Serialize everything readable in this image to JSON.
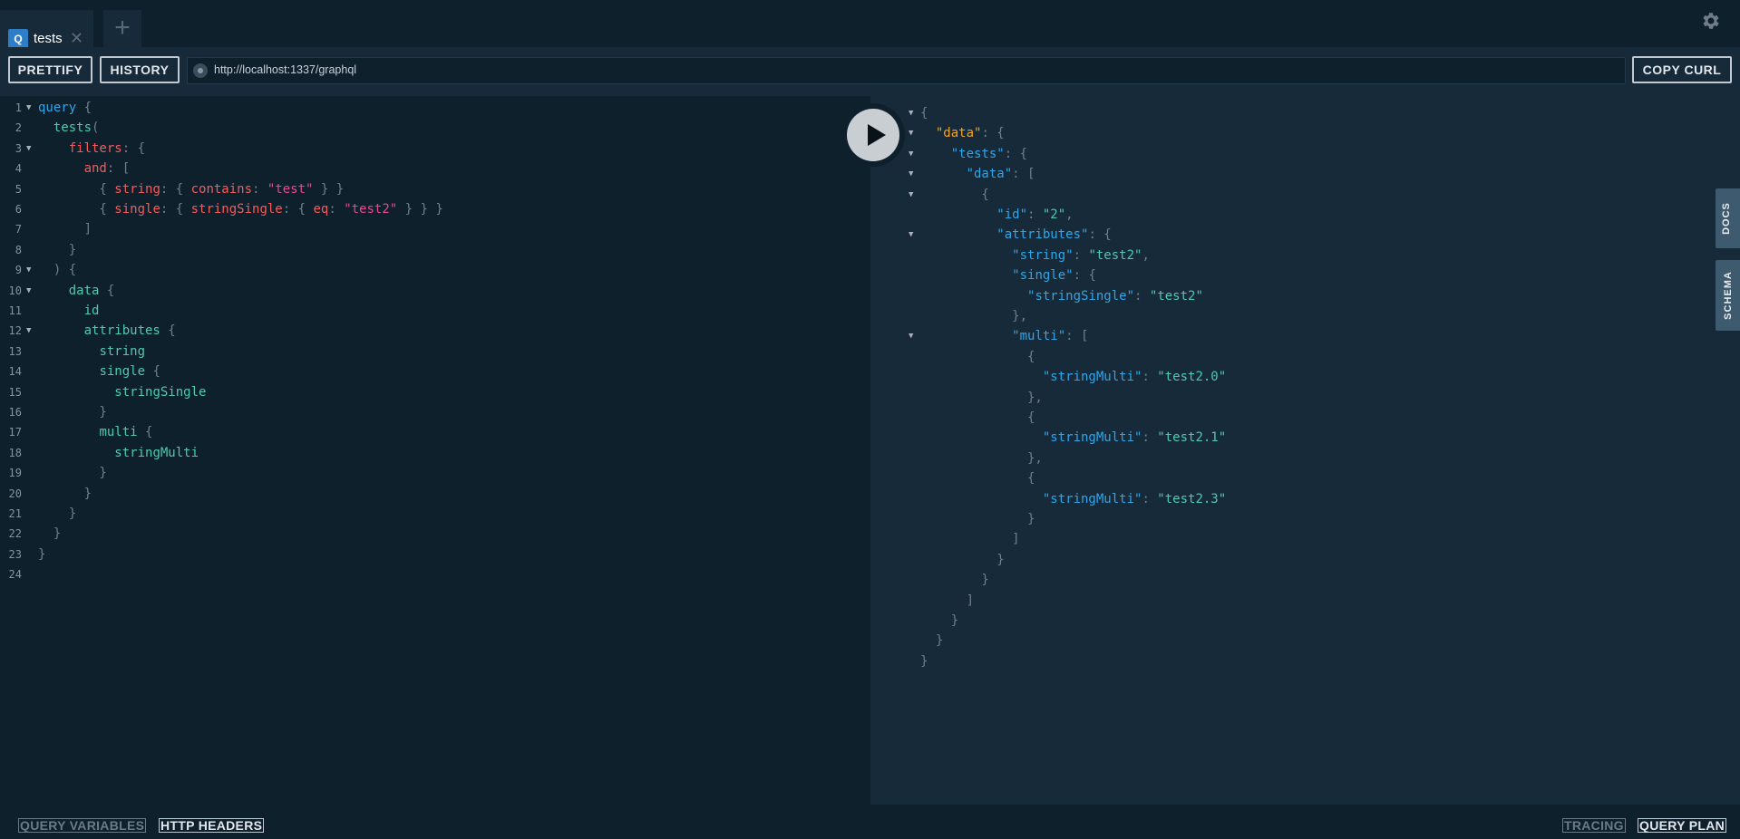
{
  "tabs": [
    {
      "icon": "Q",
      "title": "tests",
      "close": "✕"
    }
  ],
  "add_tab": "+",
  "toolbar": {
    "prettify": "PRETTIFY",
    "history": "HISTORY",
    "copy_curl": "COPY CURL"
  },
  "endpoint": "http://localhost:1337/graphql",
  "side_tabs": {
    "docs": "DOCS",
    "schema": "SCHEMA"
  },
  "footer": {
    "query_variables": "QUERY VARIABLES",
    "http_headers": "HTTP HEADERS",
    "tracing": "TRACING",
    "query_plan": "QUERY PLAN"
  },
  "query_lines": [
    {
      "n": "1",
      "fold": true,
      "parts": [
        [
          "kw",
          "query"
        ],
        [
          "pun",
          " {"
        ]
      ]
    },
    {
      "n": "2",
      "fold": false,
      "parts": [
        [
          "pun",
          "  "
        ],
        [
          "fld",
          "tests"
        ],
        [
          "pun",
          "("
        ]
      ]
    },
    {
      "n": "3",
      "fold": true,
      "parts": [
        [
          "pun",
          "    "
        ],
        [
          "arg",
          "filters"
        ],
        [
          "pun",
          ": {"
        ]
      ]
    },
    {
      "n": "4",
      "fold": false,
      "parts": [
        [
          "pun",
          "      "
        ],
        [
          "arg",
          "and"
        ],
        [
          "pun",
          ": ["
        ]
      ]
    },
    {
      "n": "5",
      "fold": false,
      "parts": [
        [
          "pun",
          "        { "
        ],
        [
          "arg",
          "string"
        ],
        [
          "pun",
          ": { "
        ],
        [
          "arg",
          "contains"
        ],
        [
          "pun",
          ": "
        ],
        [
          "str",
          "\"test\""
        ],
        [
          "pun",
          " } }"
        ]
      ]
    },
    {
      "n": "6",
      "fold": false,
      "parts": [
        [
          "pun",
          "        { "
        ],
        [
          "arg",
          "single"
        ],
        [
          "pun",
          ": { "
        ],
        [
          "arg",
          "stringSingle"
        ],
        [
          "pun",
          ": { "
        ],
        [
          "arg",
          "eq"
        ],
        [
          "pun",
          ": "
        ],
        [
          "str",
          "\"test2\""
        ],
        [
          "pun",
          " } } }"
        ]
      ]
    },
    {
      "n": "7",
      "fold": false,
      "parts": [
        [
          "pun",
          "      ]"
        ]
      ]
    },
    {
      "n": "8",
      "fold": false,
      "parts": [
        [
          "pun",
          "    }"
        ]
      ]
    },
    {
      "n": "9",
      "fold": true,
      "parts": [
        [
          "pun",
          "  ) {"
        ]
      ]
    },
    {
      "n": "10",
      "fold": true,
      "parts": [
        [
          "pun",
          "    "
        ],
        [
          "fld",
          "data"
        ],
        [
          "pun",
          " {"
        ]
      ]
    },
    {
      "n": "11",
      "fold": false,
      "parts": [
        [
          "pun",
          "      "
        ],
        [
          "fld",
          "id"
        ]
      ]
    },
    {
      "n": "12",
      "fold": true,
      "parts": [
        [
          "pun",
          "      "
        ],
        [
          "fld",
          "attributes"
        ],
        [
          "pun",
          " {"
        ]
      ]
    },
    {
      "n": "13",
      "fold": false,
      "parts": [
        [
          "pun",
          "        "
        ],
        [
          "fld",
          "string"
        ]
      ]
    },
    {
      "n": "14",
      "fold": false,
      "parts": [
        [
          "pun",
          "        "
        ],
        [
          "fld",
          "single"
        ],
        [
          "pun",
          " {"
        ]
      ]
    },
    {
      "n": "15",
      "fold": false,
      "parts": [
        [
          "pun",
          "          "
        ],
        [
          "fld",
          "stringSingle"
        ]
      ]
    },
    {
      "n": "16",
      "fold": false,
      "parts": [
        [
          "pun",
          "        }"
        ]
      ]
    },
    {
      "n": "17",
      "fold": false,
      "parts": [
        [
          "pun",
          "        "
        ],
        [
          "fld",
          "multi"
        ],
        [
          "pun",
          " {"
        ]
      ]
    },
    {
      "n": "18",
      "fold": false,
      "parts": [
        [
          "pun",
          "          "
        ],
        [
          "fld",
          "stringMulti"
        ]
      ]
    },
    {
      "n": "19",
      "fold": false,
      "parts": [
        [
          "pun",
          "        }"
        ]
      ]
    },
    {
      "n": "20",
      "fold": false,
      "parts": [
        [
          "pun",
          "      }"
        ]
      ]
    },
    {
      "n": "21",
      "fold": false,
      "parts": [
        [
          "pun",
          "    }"
        ]
      ]
    },
    {
      "n": "22",
      "fold": false,
      "parts": [
        [
          "pun",
          "  }"
        ]
      ]
    },
    {
      "n": "23",
      "fold": false,
      "parts": [
        [
          "pun",
          "}"
        ]
      ]
    },
    {
      "n": "24",
      "fold": false,
      "parts": []
    }
  ],
  "result_lines": [
    {
      "fold": true,
      "parts": [
        [
          "pun",
          "{"
        ]
      ]
    },
    {
      "fold": true,
      "parts": [
        [
          "pun",
          "  "
        ],
        [
          "rkey-data",
          "\"data\""
        ],
        [
          "pun",
          ": {"
        ]
      ]
    },
    {
      "fold": true,
      "parts": [
        [
          "pun",
          "    "
        ],
        [
          "rkey",
          "\"tests\""
        ],
        [
          "pun",
          ": {"
        ]
      ]
    },
    {
      "fold": true,
      "parts": [
        [
          "pun",
          "      "
        ],
        [
          "rkey",
          "\"data\""
        ],
        [
          "pun",
          ": ["
        ]
      ]
    },
    {
      "fold": true,
      "parts": [
        [
          "pun",
          "        {"
        ]
      ]
    },
    {
      "fold": false,
      "parts": [
        [
          "pun",
          "          "
        ],
        [
          "rkey",
          "\"id\""
        ],
        [
          "pun",
          ": "
        ],
        [
          "rstr",
          "\"2\""
        ],
        [
          "pun",
          ","
        ]
      ]
    },
    {
      "fold": true,
      "parts": [
        [
          "pun",
          "          "
        ],
        [
          "rkey",
          "\"attributes\""
        ],
        [
          "pun",
          ": {"
        ]
      ]
    },
    {
      "fold": false,
      "parts": [
        [
          "pun",
          "            "
        ],
        [
          "rkey",
          "\"string\""
        ],
        [
          "pun",
          ": "
        ],
        [
          "rstr",
          "\"test2\""
        ],
        [
          "pun",
          ","
        ]
      ]
    },
    {
      "fold": false,
      "parts": [
        [
          "pun",
          "            "
        ],
        [
          "rkey",
          "\"single\""
        ],
        [
          "pun",
          ": {"
        ]
      ]
    },
    {
      "fold": false,
      "parts": [
        [
          "pun",
          "              "
        ],
        [
          "rkey",
          "\"stringSingle\""
        ],
        [
          "pun",
          ": "
        ],
        [
          "rstr",
          "\"test2\""
        ]
      ]
    },
    {
      "fold": false,
      "parts": [
        [
          "pun",
          "            },"
        ]
      ]
    },
    {
      "fold": true,
      "parts": [
        [
          "pun",
          "            "
        ],
        [
          "rkey",
          "\"multi\""
        ],
        [
          "pun",
          ": ["
        ]
      ]
    },
    {
      "fold": false,
      "parts": [
        [
          "pun",
          "              {"
        ]
      ]
    },
    {
      "fold": false,
      "parts": [
        [
          "pun",
          "                "
        ],
        [
          "rkey",
          "\"stringMulti\""
        ],
        [
          "pun",
          ": "
        ],
        [
          "rstr",
          "\"test2.0\""
        ]
      ]
    },
    {
      "fold": false,
      "parts": [
        [
          "pun",
          "              },"
        ]
      ]
    },
    {
      "fold": false,
      "parts": [
        [
          "pun",
          "              {"
        ]
      ]
    },
    {
      "fold": false,
      "parts": [
        [
          "pun",
          "                "
        ],
        [
          "rkey",
          "\"stringMulti\""
        ],
        [
          "pun",
          ": "
        ],
        [
          "rstr",
          "\"test2.1\""
        ]
      ]
    },
    {
      "fold": false,
      "parts": [
        [
          "pun",
          "              },"
        ]
      ]
    },
    {
      "fold": false,
      "parts": [
        [
          "pun",
          "              {"
        ]
      ]
    },
    {
      "fold": false,
      "parts": [
        [
          "pun",
          "                "
        ],
        [
          "rkey",
          "\"stringMulti\""
        ],
        [
          "pun",
          ": "
        ],
        [
          "rstr",
          "\"test2.3\""
        ]
      ]
    },
    {
      "fold": false,
      "parts": [
        [
          "pun",
          "              }"
        ]
      ]
    },
    {
      "fold": false,
      "parts": [
        [
          "pun",
          "            ]"
        ]
      ]
    },
    {
      "fold": false,
      "parts": [
        [
          "pun",
          "          }"
        ]
      ]
    },
    {
      "fold": false,
      "parts": [
        [
          "pun",
          "        }"
        ]
      ]
    },
    {
      "fold": false,
      "parts": [
        [
          "pun",
          "      ]"
        ]
      ]
    },
    {
      "fold": false,
      "parts": [
        [
          "pun",
          "    }"
        ]
      ]
    },
    {
      "fold": false,
      "parts": [
        [
          "pun",
          "  }"
        ]
      ]
    },
    {
      "fold": false,
      "parts": [
        [
          "pun",
          "}"
        ]
      ]
    }
  ]
}
